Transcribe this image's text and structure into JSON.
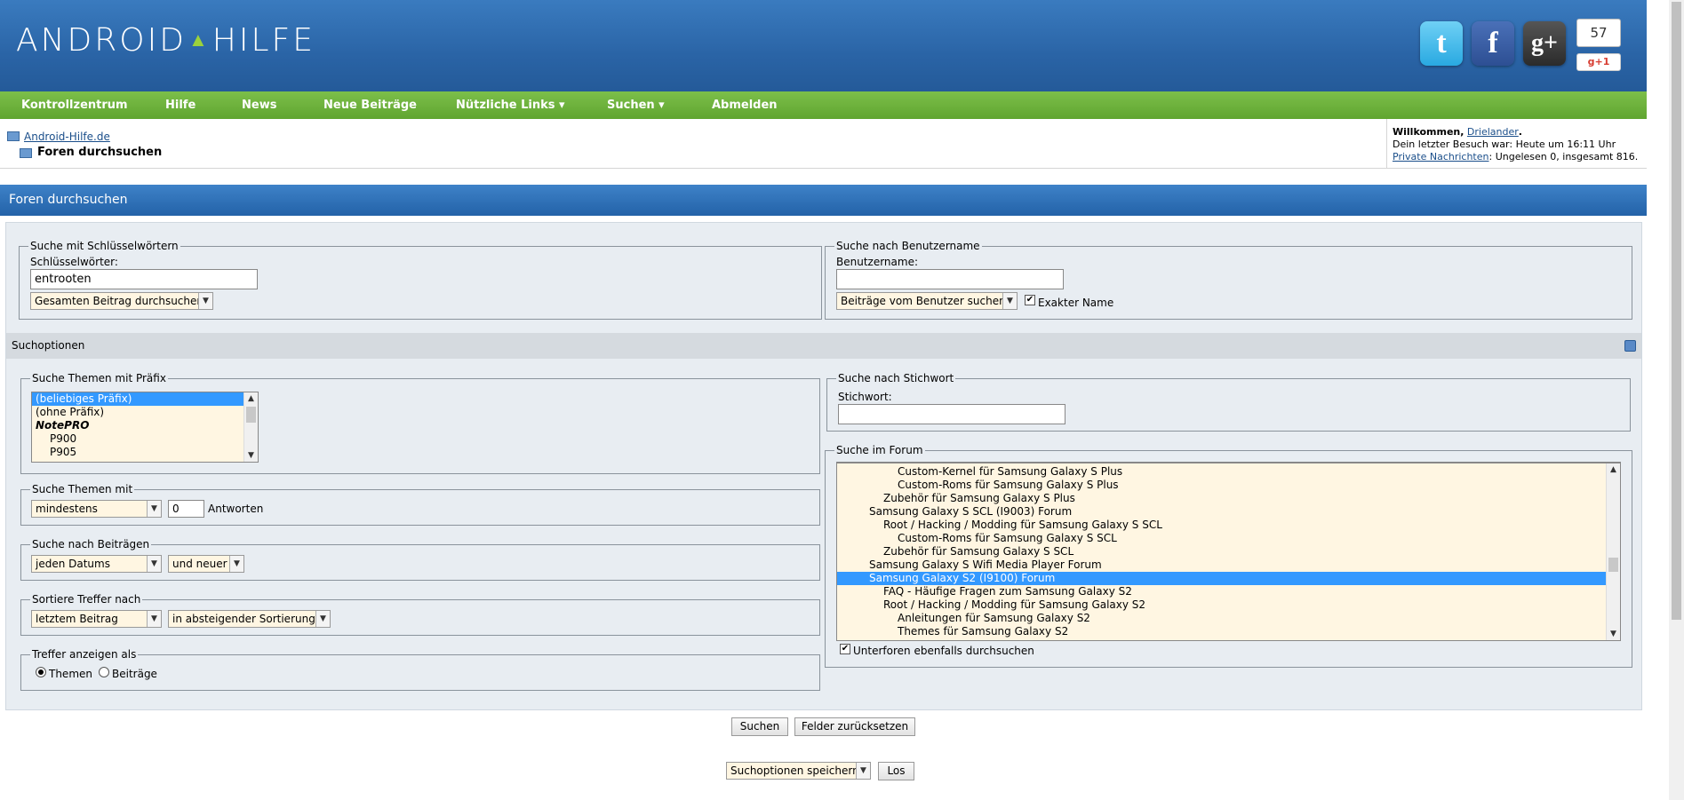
{
  "header": {
    "logo_left": "ANDROID",
    "logo_right": "HILFE",
    "social": {
      "twitter": "t",
      "facebook": "f",
      "gplus": "g+"
    },
    "gplus_count": "57",
    "gplus_button": "g+1"
  },
  "nav": {
    "items": [
      "Kontrollzentrum",
      "Hilfe",
      "News",
      "Neue Beiträge",
      "Nützliche Links ▾",
      "Suchen ▾",
      "Abmelden"
    ]
  },
  "breadcrumb": {
    "home": "Android-Hilfe.de",
    "current": "Foren durchsuchen"
  },
  "welcome": {
    "greeting": "Willkommen,",
    "user": "Drielander",
    "period": ".",
    "last_visit": "Dein letzter Besuch war: Heute um 16:11 Uhr",
    "pm_link": "Private Nachrichten",
    "pm_text": ": Ungelesen 0, insgesamt 816."
  },
  "title": "Foren durchsuchen",
  "keywords": {
    "legend": "Suche mit Schlüsselwörtern",
    "label": "Schlüsselwörter:",
    "value": "entrooten",
    "mode": "Gesamten Beitrag durchsuchen"
  },
  "username": {
    "legend": "Suche nach Benutzername",
    "label": "Benutzername:",
    "value": "",
    "mode": "Beiträge vom Benutzer suchen",
    "exact_label": "Exakter Name"
  },
  "options_bar": "Suchoptionen",
  "prefix": {
    "legend": "Suche Themen mit Präfix",
    "items": [
      "(beliebiges Präfix)",
      "(ohne Präfix)",
      "NotePRO",
      "P900",
      "P905"
    ]
  },
  "replies": {
    "legend": "Suche Themen mit",
    "mode": "mindestens",
    "value": "0",
    "unit": "Antworten"
  },
  "posts": {
    "legend": "Suche nach Beiträgen",
    "date": "jeden Datums",
    "direction": "und neuer"
  },
  "sort": {
    "legend": "Sortiere Treffer nach",
    "by": "letztem Beitrag",
    "order": "in absteigender Sortierung"
  },
  "display": {
    "legend": "Treffer anzeigen als",
    "opt1": "Themen",
    "opt2": "Beiträge"
  },
  "tag": {
    "legend": "Suche nach Stichwort",
    "label": "Stichwort:",
    "value": ""
  },
  "forum": {
    "legend": "Suche im Forum",
    "items": [
      "Custom-Kernel für Samsung Galaxy S Plus",
      "Custom-Roms für Samsung Galaxy S Plus",
      "Zubehör für Samsung Galaxy S Plus",
      "Samsung Galaxy S SCL (I9003) Forum",
      "Root / Hacking / Modding für Samsung Galaxy S SCL",
      "Custom-Roms für Samsung Galaxy S SCL",
      "Zubehör für Samsung Galaxy S SCL",
      "Samsung Galaxy S Wifi Media Player Forum",
      "Samsung Galaxy S2 (I9100) Forum",
      "FAQ - Häufige Fragen zum Samsung Galaxy S2",
      "Root / Hacking / Modding für Samsung Galaxy S2",
      "Anleitungen für Samsung Galaxy S2",
      "Themes für Samsung Galaxy S2"
    ],
    "subforums_label": "Unterforen ebenfalls durchsuchen"
  },
  "buttons": {
    "search": "Suchen",
    "reset": "Felder zurücksetzen",
    "save_select": "Suchoptionen speichern",
    "go": "Los"
  }
}
